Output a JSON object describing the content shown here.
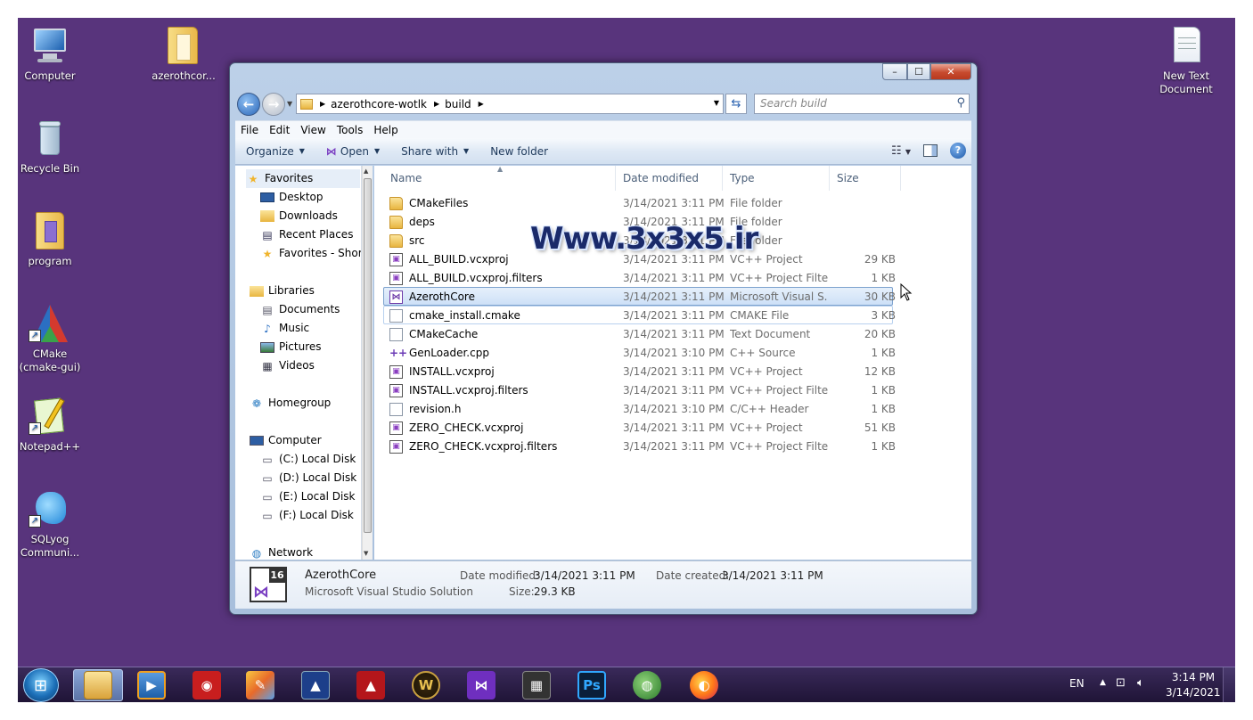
{
  "desktop": {
    "icons": [
      {
        "label": "Computer",
        "icon": "computer-icon"
      },
      {
        "label": "azerothcor...",
        "icon": "folder-icon"
      },
      {
        "label": "Recycle Bin",
        "icon": "recycle-bin-icon"
      },
      {
        "label": "program",
        "icon": "folder-icon"
      },
      {
        "label": "CMake\n(cmake-gui)",
        "icon": "cmake-icon"
      },
      {
        "label": "Notepad++",
        "icon": "notepadpp-icon"
      },
      {
        "label": "SQLyog\nCommuni...",
        "icon": "sqlyog-icon"
      },
      {
        "label": "New Text\nDocument",
        "icon": "text-document-icon"
      }
    ],
    "background_color": "#58347c"
  },
  "window": {
    "caption_buttons": {
      "minimize": "–",
      "maximize": "☐",
      "close": "✕"
    },
    "address": {
      "segments": [
        "azerothcore-wotlk",
        "build"
      ]
    },
    "search": {
      "placeholder": "Search build"
    },
    "menu": [
      "File",
      "Edit",
      "View",
      "Tools",
      "Help"
    ],
    "commands": {
      "organize": "Organize",
      "open": "Open",
      "share_with": "Share with",
      "new_folder": "New folder"
    },
    "nav": {
      "favorites": {
        "label": "Favorites",
        "items": [
          "Desktop",
          "Downloads",
          "Recent Places",
          "Favorites - Shortc"
        ]
      },
      "libraries": {
        "label": "Libraries",
        "items": [
          "Documents",
          "Music",
          "Pictures",
          "Videos"
        ]
      },
      "homegroup": "Homegroup",
      "computer": {
        "label": "Computer",
        "items": [
          "(C:) Local Disk",
          "(D:) Local Disk",
          "(E:) Local Disk",
          "(F:) Local Disk"
        ]
      },
      "network": "Network"
    },
    "columns": {
      "name": "Name",
      "date": "Date modified",
      "type": "Type",
      "size": "Size"
    },
    "files": [
      {
        "name": "CMakeFiles",
        "date": "3/14/2021 3:11 PM",
        "type": "File folder",
        "size": "",
        "icon": "folder"
      },
      {
        "name": "deps",
        "date": "3/14/2021 3:11 PM",
        "type": "File folder",
        "size": "",
        "icon": "folder"
      },
      {
        "name": "src",
        "date": "3/14/2021 3:11 PM",
        "type": "File folder",
        "size": "",
        "icon": "folder"
      },
      {
        "name": "ALL_BUILD.vcxproj",
        "date": "3/14/2021 3:11 PM",
        "type": "VC++ Project",
        "size": "29 KB",
        "icon": "proj"
      },
      {
        "name": "ALL_BUILD.vcxproj.filters",
        "date": "3/14/2021 3:11 PM",
        "type": "VC++ Project Filte...",
        "size": "1 KB",
        "icon": "proj"
      },
      {
        "name": "AzerothCore",
        "date": "3/14/2021 3:11 PM",
        "type": "Microsoft Visual S...",
        "size": "30 KB",
        "icon": "vs"
      },
      {
        "name": "cmake_install.cmake",
        "date": "3/14/2021 3:11 PM",
        "type": "CMAKE File",
        "size": "3 KB",
        "icon": "doc"
      },
      {
        "name": "CMakeCache",
        "date": "3/14/2021 3:11 PM",
        "type": "Text Document",
        "size": "20 KB",
        "icon": "doc"
      },
      {
        "name": "GenLoader.cpp",
        "date": "3/14/2021 3:10 PM",
        "type": "C++ Source",
        "size": "1 KB",
        "icon": "cpp"
      },
      {
        "name": "INSTALL.vcxproj",
        "date": "3/14/2021 3:11 PM",
        "type": "VC++ Project",
        "size": "12 KB",
        "icon": "proj"
      },
      {
        "name": "INSTALL.vcxproj.filters",
        "date": "3/14/2021 3:11 PM",
        "type": "VC++ Project Filte...",
        "size": "1 KB",
        "icon": "proj"
      },
      {
        "name": "revision.h",
        "date": "3/14/2021 3:10 PM",
        "type": "C/C++ Header",
        "size": "1 KB",
        "icon": "doc"
      },
      {
        "name": "ZERO_CHECK.vcxproj",
        "date": "3/14/2021 3:11 PM",
        "type": "VC++ Project",
        "size": "51 KB",
        "icon": "proj"
      },
      {
        "name": "ZERO_CHECK.vcxproj.filters",
        "date": "3/14/2021 3:11 PM",
        "type": "VC++ Project Filte...",
        "size": "1 KB",
        "icon": "proj"
      }
    ],
    "details": {
      "name": "AzerothCore",
      "type": "Microsoft Visual Studio Solution",
      "date_modified_label": "Date modified:",
      "date_modified": "3/14/2021 3:11 PM",
      "date_created_label": "Date created:",
      "date_created": "3/14/2021 3:11 PM",
      "size_label": "Size:",
      "size": "29.3 KB",
      "icon_badge": "16"
    }
  },
  "watermark": "Www.3x3x5.ir",
  "taskbar": {
    "apps": [
      "windows-explorer",
      "media-player",
      "record-app",
      "paint-app",
      "adobe-app",
      "autocad-app",
      "wow-app",
      "visual-studio",
      "video-editor",
      "photoshop",
      "ie-app",
      "firefox"
    ],
    "photoshop_label": "Ps",
    "wow_label": "W",
    "tray": {
      "language": "EN",
      "time": "3:14 PM",
      "date": "3/14/2021"
    }
  }
}
